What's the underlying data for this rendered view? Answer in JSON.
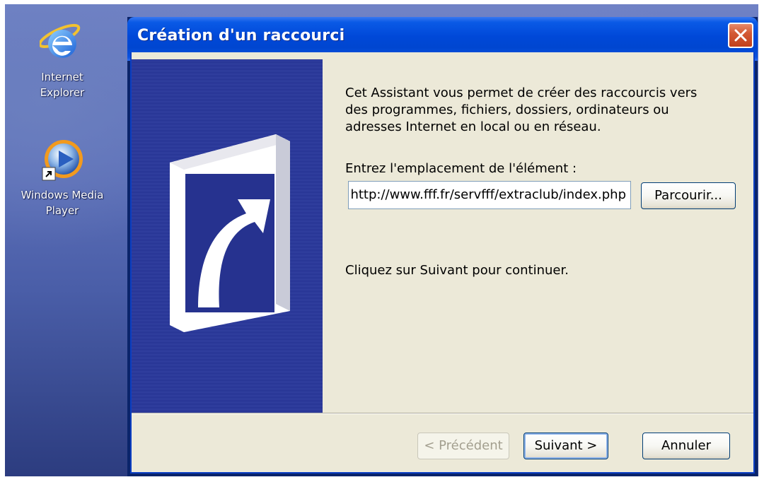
{
  "desktop": {
    "icons": [
      {
        "label_line1": "Internet",
        "label_line2": "Explorer",
        "icon": "internet-explorer-icon"
      },
      {
        "label_line1": "Windows Media",
        "label_line2": "Player",
        "icon": "windows-media-player-icon"
      }
    ]
  },
  "dialog": {
    "title": "Création d'un raccourci",
    "intro_line1": "Cet Assistant vous permet de créer des raccourcis vers",
    "intro_line2": "des programmes, fichiers, dossiers, ordinateurs ou",
    "intro_line3": "adresses Internet en local ou en réseau.",
    "location_label": "Entrez l'emplacement de l'élément :",
    "location_value": "http://www.fff.fr/servfff/extraclub/index.php",
    "browse_label": "Parcourir...",
    "continue_text": "Cliquez sur Suivant pour continuer.",
    "buttons": {
      "previous": "< Précédent",
      "next": "Suivant >",
      "cancel": "Annuler"
    }
  },
  "colors": {
    "titlebar": "#0048d8",
    "side_panel": "#1e2a8c",
    "client_bg": "#ece9d8",
    "close_button": "#d45a35"
  }
}
